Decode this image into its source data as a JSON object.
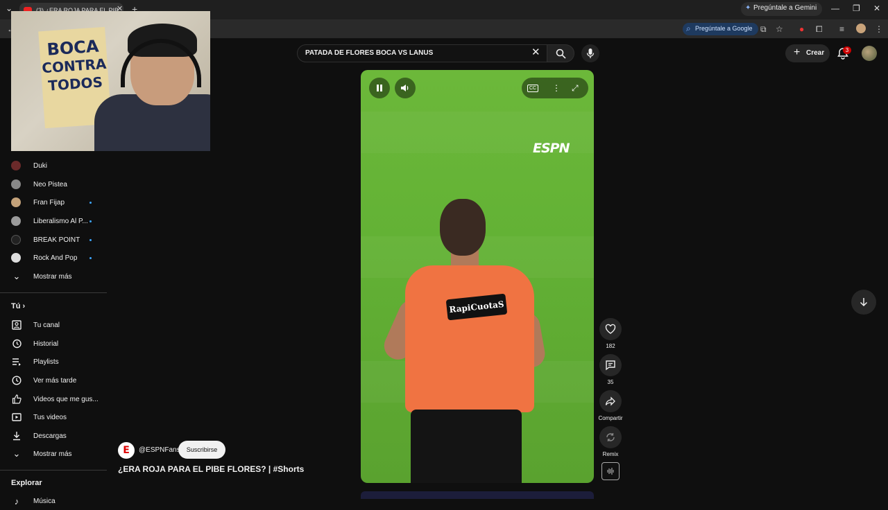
{
  "browser": {
    "tab_title": "(3) ¿ERA ROJA PARA EL PIB...",
    "gemini_label": "Pregúntale a Gemini",
    "ask_google_label": "Pregúntale a Google"
  },
  "webcam": {
    "flag_lines": [
      "BOCA",
      "CONTRA",
      "TODOS"
    ]
  },
  "sidebar": {
    "subscriptions": [
      {
        "label": "Duki",
        "new": false,
        "color": "#6b2a2a"
      },
      {
        "label": "Neo Pistea",
        "new": false,
        "color": "#888888"
      },
      {
        "label": "Fran Fijap",
        "new": true,
        "color": "#c4a27a"
      },
      {
        "label": "Liberalismo Al P...",
        "new": true,
        "color": "#9a9a9a"
      },
      {
        "label": "BREAK POINT",
        "new": true,
        "color": "#222222"
      },
      {
        "label": "Rock And Pop",
        "new": true,
        "color": "#dddddd"
      }
    ],
    "show_more_1": "Mostrar más",
    "you_section": "Tú",
    "you_items": [
      {
        "label": "Tu canal",
        "icon": "channel-icon"
      },
      {
        "label": "Historial",
        "icon": "history-icon"
      },
      {
        "label": "Playlists",
        "icon": "playlists-icon"
      },
      {
        "label": "Ver más tarde",
        "icon": "watch-later-icon"
      },
      {
        "label": "Videos que me gus...",
        "icon": "liked-icon"
      },
      {
        "label": "Tus videos",
        "icon": "your-videos-icon"
      },
      {
        "label": "Descargas",
        "icon": "downloads-icon"
      }
    ],
    "show_more_2": "Mostrar más",
    "explore_section": "Explorar",
    "explore_first": "Música"
  },
  "header": {
    "search_value": "PATADA DE FLORES BOCA VS LANUS",
    "create_label": "Crear",
    "notification_count": "3"
  },
  "video": {
    "watermark": "ESPN",
    "sponsor": "RapiCuotaS"
  },
  "actions": {
    "likes": "182",
    "comments": "35",
    "share": "Compartir",
    "remix": "Remix"
  },
  "channel": {
    "handle": "@ESPNFans",
    "subscribe": "Suscribirse",
    "title": "¿ERA ROJA PARA EL PIBE FLORES? | #Shorts"
  }
}
